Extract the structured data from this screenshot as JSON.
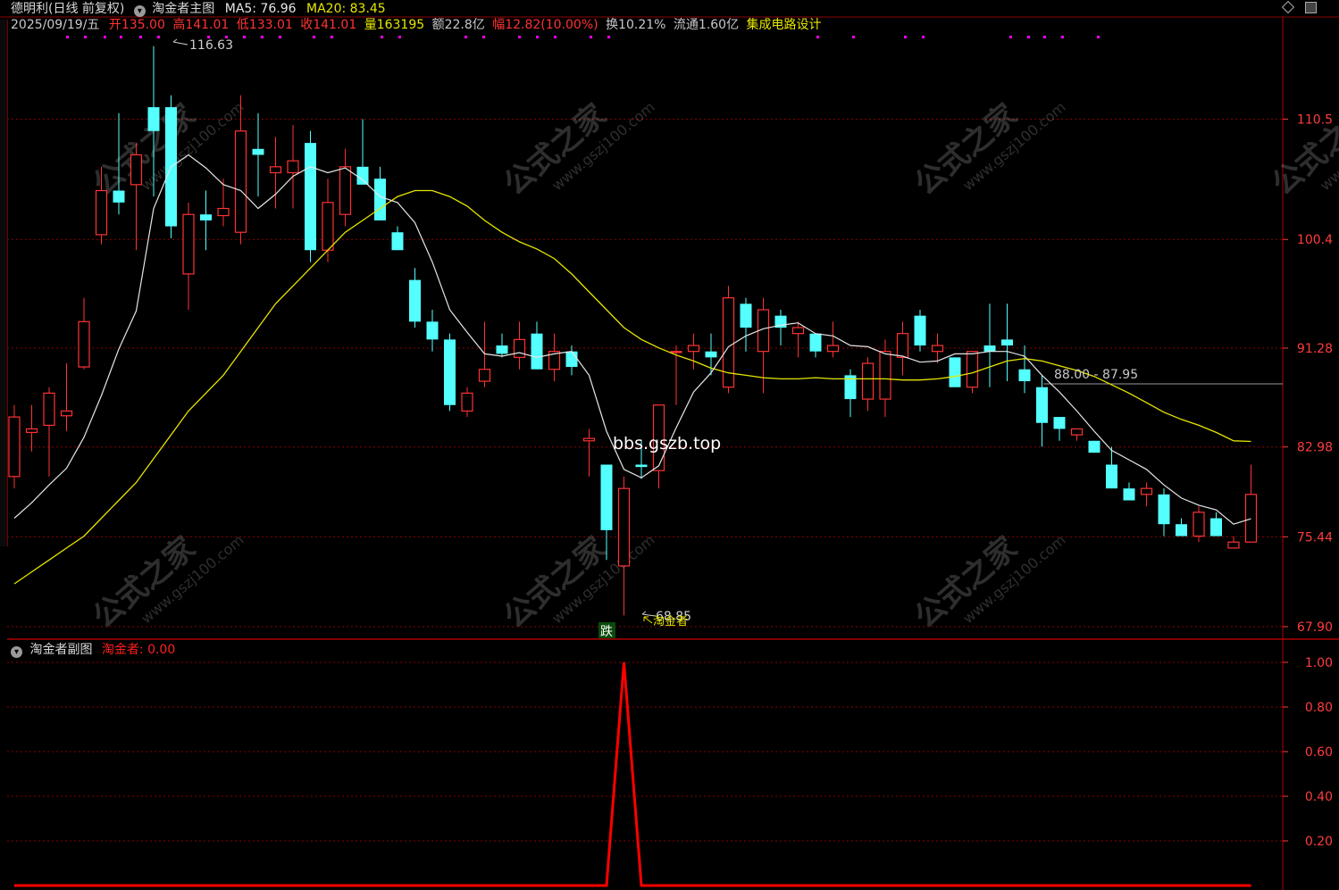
{
  "header": {
    "stock_label": "德明利(日线 前复权)",
    "main_indicator_name": "淘金者主图",
    "ma5_label": "MA5: 76.96",
    "ma20_label": "MA20: 83.45",
    "date_label": "2025/09/19/五",
    "open_label": "开135.00",
    "high_label": "高141.01",
    "low_label": "低133.01",
    "close_label": "收141.01",
    "volume_label": "量163195",
    "amount_label": "额22.8亿",
    "change_label": "幅12.82(10.00%)",
    "turnover_label": "换10.21%",
    "float_label": "流通1.60亿",
    "sector_label": "集成电路设计"
  },
  "sub_header": {
    "name": "淘金者副图",
    "value_label": "淘金者: 0.00"
  },
  "annotations": {
    "high_marker": "116.63",
    "low_marker": "68.85",
    "signal_text": "淘金者",
    "fall_badge": "跌",
    "range_label": "88.00 - 87.95",
    "watermark_site": "bbs.gszb.top",
    "watermark_cn": "公式之家",
    "watermark_url": "www.gszj100.com"
  },
  "colors": {
    "up": "#ff3232",
    "down": "#54ffff",
    "ma5": "#e6e6e6",
    "ma20": "#e6e600",
    "grid": "#8b0000",
    "axis_text": "#ff3c3c",
    "signal": "#ff0000",
    "magenta": "#ff00ff"
  },
  "chart_data": [
    {
      "type": "candlestick",
      "title": "淘金者主图",
      "ylim": [
        67.9,
        117.5
      ],
      "y_ticks": [
        110.5,
        100.4,
        91.28,
        82.98,
        75.44,
        67.9
      ],
      "y_tick_labels": [
        "110.5",
        "100.4",
        "91.28",
        "82.98",
        "75.44",
        "67.90"
      ],
      "grid": true,
      "ohlc": [
        [
          80.5,
          86.5,
          79.5,
          85.5
        ],
        [
          84.2,
          86.5,
          82.6,
          84.5
        ],
        [
          84.8,
          88.0,
          80.5,
          87.5
        ],
        [
          85.6,
          90.0,
          84.3,
          86.0
        ],
        [
          89.7,
          95.5,
          89.5,
          93.5
        ],
        [
          100.8,
          106.5,
          100.0,
          104.5
        ],
        [
          104.5,
          111.0,
          102.5,
          103.5
        ],
        [
          105.0,
          108.5,
          99.5,
          107.5
        ],
        [
          111.5,
          116.63,
          104.0,
          109.5
        ],
        [
          111.5,
          112.5,
          100.5,
          101.5
        ],
        [
          97.5,
          103.5,
          94.5,
          102.5
        ],
        [
          102.5,
          104.5,
          99.5,
          102.0
        ],
        [
          102.4,
          105.5,
          101.5,
          103.0
        ],
        [
          101.0,
          112.5,
          100.0,
          109.5
        ],
        [
          108.0,
          111.0,
          104.0,
          107.5
        ],
        [
          106.0,
          109.0,
          103.0,
          106.5
        ],
        [
          106.0,
          110.0,
          103.0,
          107.0
        ],
        [
          108.5,
          109.5,
          98.5,
          99.5
        ],
        [
          99.5,
          105.5,
          98.5,
          103.5
        ],
        [
          102.5,
          108.0,
          101.5,
          106.5
        ],
        [
          106.5,
          110.5,
          105.5,
          105.0
        ],
        [
          105.5,
          106.5,
          102.0,
          102.0
        ],
        [
          101.0,
          101.5,
          99.5,
          99.5
        ],
        [
          97.0,
          98.0,
          93.0,
          93.5
        ],
        [
          93.5,
          94.5,
          91.0,
          92.0
        ],
        [
          92.0,
          92.5,
          86.0,
          86.5
        ],
        [
          86.0,
          88.0,
          85.5,
          87.5
        ],
        [
          88.5,
          93.5,
          88.0,
          89.5
        ],
        [
          91.5,
          92.5,
          90.5,
          90.8
        ],
        [
          90.5,
          93.5,
          89.5,
          92.0
        ],
        [
          92.5,
          93.5,
          89.5,
          89.5
        ],
        [
          89.5,
          92.5,
          88.5,
          91.0
        ],
        [
          91.0,
          91.5,
          89.0,
          89.7
        ],
        [
          83.5,
          84.5,
          80.5,
          83.7
        ],
        [
          81.5,
          79.5,
          73.5,
          76.0
        ],
        [
          73.0,
          80.5,
          68.85,
          79.5
        ],
        [
          81.5,
          83.5,
          80.3,
          81.3
        ],
        [
          81.0,
          84.5,
          79.5,
          86.5
        ],
        [
          91.0,
          91.5,
          86.5,
          91.0
        ],
        [
          91.0,
          92.5,
          89.5,
          91.5
        ],
        [
          91.0,
          92.5,
          89.0,
          90.5
        ],
        [
          88.0,
          96.5,
          87.5,
          95.5
        ],
        [
          95.0,
          95.5,
          91.0,
          93.0
        ],
        [
          91.0,
          95.5,
          87.5,
          94.5
        ],
        [
          94.0,
          94.5,
          91.5,
          93.0
        ],
        [
          92.5,
          93.5,
          90.5,
          93.0
        ],
        [
          92.5,
          92.5,
          90.5,
          91.0
        ],
        [
          91.0,
          93.5,
          90.5,
          91.5
        ],
        [
          89.0,
          89.5,
          85.5,
          87.0
        ],
        [
          87.0,
          90.5,
          86.0,
          90.0
        ],
        [
          87.0,
          92.0,
          85.5,
          91.0
        ],
        [
          90.5,
          93.5,
          89.0,
          92.5
        ],
        [
          94.0,
          94.5,
          91.0,
          91.5
        ],
        [
          91.0,
          92.5,
          90.0,
          91.5
        ],
        [
          90.5,
          90.5,
          88.5,
          88.0
        ],
        [
          88.0,
          91.0,
          87.5,
          91.0
        ],
        [
          91.5,
          95.0,
          88.0,
          91.0
        ],
        [
          92.0,
          95.0,
          88.5,
          91.5
        ],
        [
          89.5,
          91.5,
          87.5,
          88.5
        ],
        [
          88.0,
          89.0,
          83.0,
          85.0
        ],
        [
          85.5,
          85.5,
          83.5,
          84.5
        ],
        [
          84.0,
          84.5,
          83.5,
          84.5
        ],
        [
          83.5,
          83.5,
          82.5,
          82.5
        ],
        [
          81.5,
          83.0,
          79.5,
          79.5
        ],
        [
          79.5,
          80.0,
          78.5,
          78.5
        ],
        [
          79.0,
          80.0,
          78.0,
          79.5
        ],
        [
          79.0,
          79.5,
          75.5,
          76.5
        ],
        [
          76.5,
          77.0,
          75.5,
          75.5
        ],
        [
          75.5,
          78.0,
          75.0,
          77.5
        ],
        [
          77.0,
          77.5,
          75.5,
          75.5
        ],
        [
          74.5,
          75.5,
          74.5,
          75.0
        ],
        [
          75.0,
          81.5,
          75.0,
          79.0
        ]
      ],
      "ma5": [
        77.0,
        78.3,
        79.8,
        81.2,
        83.8,
        87.3,
        91.2,
        94.4,
        103.0,
        106.5,
        107.5,
        106.4,
        105.0,
        104.5,
        103.0,
        104.2,
        105.7,
        106.5,
        106.0,
        106.4,
        105.4,
        104.0,
        103.5,
        101.8,
        98.5,
        94.5,
        92.6,
        90.8,
        90.6,
        90.9,
        90.5,
        90.8,
        91.0,
        89.0,
        84.3,
        81.1,
        80.4,
        81.4,
        84.6,
        87.6,
        89.2,
        91.4,
        92.3,
        92.9,
        93.2,
        93.4,
        92.5,
        92.3,
        91.5,
        91.4,
        90.8,
        90.6,
        90.1,
        90.2,
        90.8,
        90.8,
        91.0,
        91.0,
        90.6,
        89.0,
        87.6,
        86.0,
        84.3,
        82.7,
        81.9,
        81.1,
        79.8,
        78.7,
        78.1,
        77.7,
        76.5,
        76.96
      ],
      "ma20": [
        71.5,
        72.5,
        73.5,
        74.5,
        75.5,
        77.0,
        78.5,
        80.0,
        82.0,
        84.0,
        86.0,
        87.5,
        89.0,
        91.0,
        93.0,
        95.0,
        96.5,
        98.0,
        99.5,
        101.0,
        102.0,
        103.0,
        104.0,
        104.5,
        104.5,
        104.0,
        103.2,
        102.0,
        101.0,
        100.2,
        99.6,
        98.8,
        97.5,
        96.0,
        94.5,
        93.0,
        92.0,
        91.3,
        90.7,
        90.2,
        89.6,
        89.2,
        89.0,
        88.8,
        88.7,
        88.7,
        88.8,
        88.7,
        88.7,
        88.7,
        88.7,
        88.6,
        88.6,
        88.7,
        88.9,
        89.2,
        89.7,
        90.2,
        90.4,
        90.2,
        89.8,
        89.4,
        88.9,
        88.2,
        87.5,
        86.7,
        85.9,
        85.3,
        84.8,
        84.2,
        83.5,
        83.45
      ]
    },
    {
      "type": "line",
      "title": "淘金者副图",
      "series": [
        {
          "name": "淘金者",
          "values": [
            0,
            0,
            0,
            0,
            0,
            0,
            0,
            0,
            0,
            0,
            0,
            0,
            0,
            0,
            0,
            0,
            0,
            0,
            0,
            0,
            0,
            0,
            0,
            0,
            0,
            0,
            0,
            0,
            0,
            0,
            0,
            0,
            0,
            0,
            0,
            1,
            0,
            0,
            0,
            0,
            0,
            0,
            0,
            0,
            0,
            0,
            0,
            0,
            0,
            0,
            0,
            0,
            0,
            0,
            0,
            0,
            0,
            0,
            0,
            0,
            0,
            0,
            0,
            0,
            0,
            0,
            0,
            0,
            0,
            0,
            0,
            0
          ]
        }
      ],
      "ylim": [
        0,
        1.05
      ],
      "y_ticks": [
        1.0,
        0.8,
        0.6,
        0.4,
        0.2
      ],
      "y_tick_labels": [
        "1.00",
        "0.80",
        "0.60",
        "0.40",
        "0.20"
      ],
      "grid": true
    }
  ]
}
